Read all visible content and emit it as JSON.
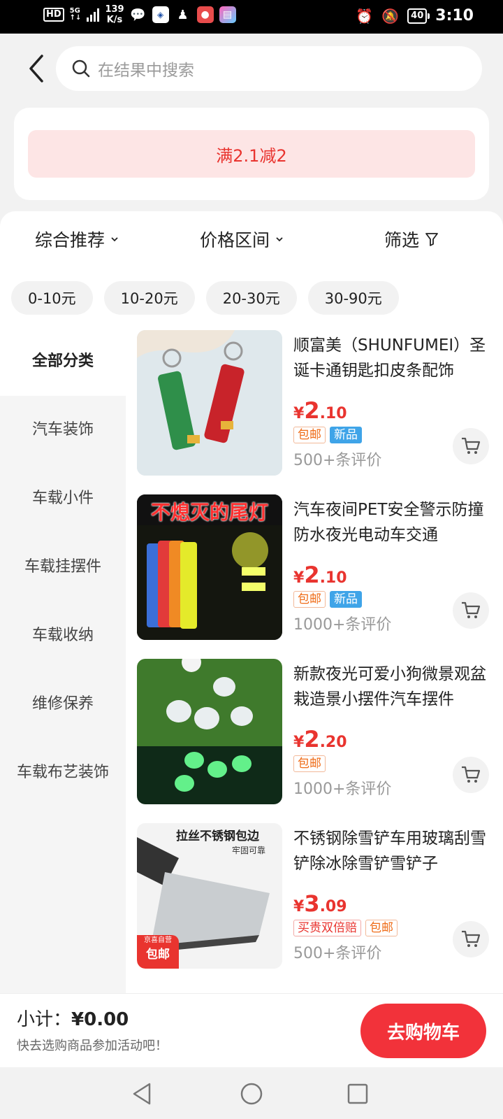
{
  "status_bar": {
    "hd": "HD",
    "network": "5G",
    "speed_value": "139",
    "speed_unit": "K/s",
    "battery": "40",
    "time": "3:10",
    "icons": [
      "wechat-icon",
      "bank-icon",
      "qq-icon",
      "app-icon",
      "wallet-icon",
      "alarm-icon",
      "mute-icon"
    ]
  },
  "search": {
    "placeholder": "在结果中搜索"
  },
  "promo": {
    "label": "满2.1减2"
  },
  "sort_bar": {
    "comprehensive": "综合推荐",
    "price_range": "价格区间",
    "filter": "筛选"
  },
  "price_chips": [
    "0-10元",
    "10-20元",
    "20-30元",
    "30-90元"
  ],
  "categories": {
    "active": "全部分类",
    "items": [
      "汽车装饰",
      "车载小件",
      "车载挂摆件",
      "车载收纳",
      "维修保养",
      "车载布艺装饰"
    ]
  },
  "products": [
    {
      "title": "顺富美（SHUNFUMEI）圣诞卡通钥匙扣皮条配饰",
      "currency": "¥",
      "price_int": "2",
      "price_dec": ".10",
      "tags": [
        "包邮",
        "新品"
      ],
      "reviews": "500+条评价"
    },
    {
      "title": "汽车夜间PET安全警示防撞防水夜光电动车交通",
      "currency": "¥",
      "price_int": "2",
      "price_dec": ".10",
      "tags": [
        "包邮",
        "新品"
      ],
      "reviews": "1000+条评价",
      "image_text": "不熄灭的尾灯"
    },
    {
      "title": "新款夜光可爱小狗微景观盆栽造景小摆件汽车摆件",
      "currency": "¥",
      "price_int": "2",
      "price_dec": ".20",
      "tags": [
        "包邮"
      ],
      "reviews": "1000+条评价"
    },
    {
      "title": "不锈钢除雪铲车用玻璃刮雪铲除冰除雪铲雪铲子",
      "currency": "¥",
      "price_int": "3",
      "price_dec": ".09",
      "tags": [
        "买贵双倍赔",
        "包邮"
      ],
      "reviews": "500+条评价",
      "image_text": "拉丝不锈钢包边",
      "image_subtext": "牢固可靠",
      "image_badge_top": "京喜自营",
      "image_badge_bottom": "包邮"
    }
  ],
  "checkout": {
    "subtotal_label": "小计：",
    "subtotal_amount": "¥0.00",
    "hint": "快去选购商品参加活动吧！",
    "button": "去购物车"
  },
  "colors": {
    "accent_red": "#e9342f",
    "button_red": "#f2323a",
    "promo_bg": "#fde5e5",
    "new_tag_blue": "#3fa4e8"
  }
}
